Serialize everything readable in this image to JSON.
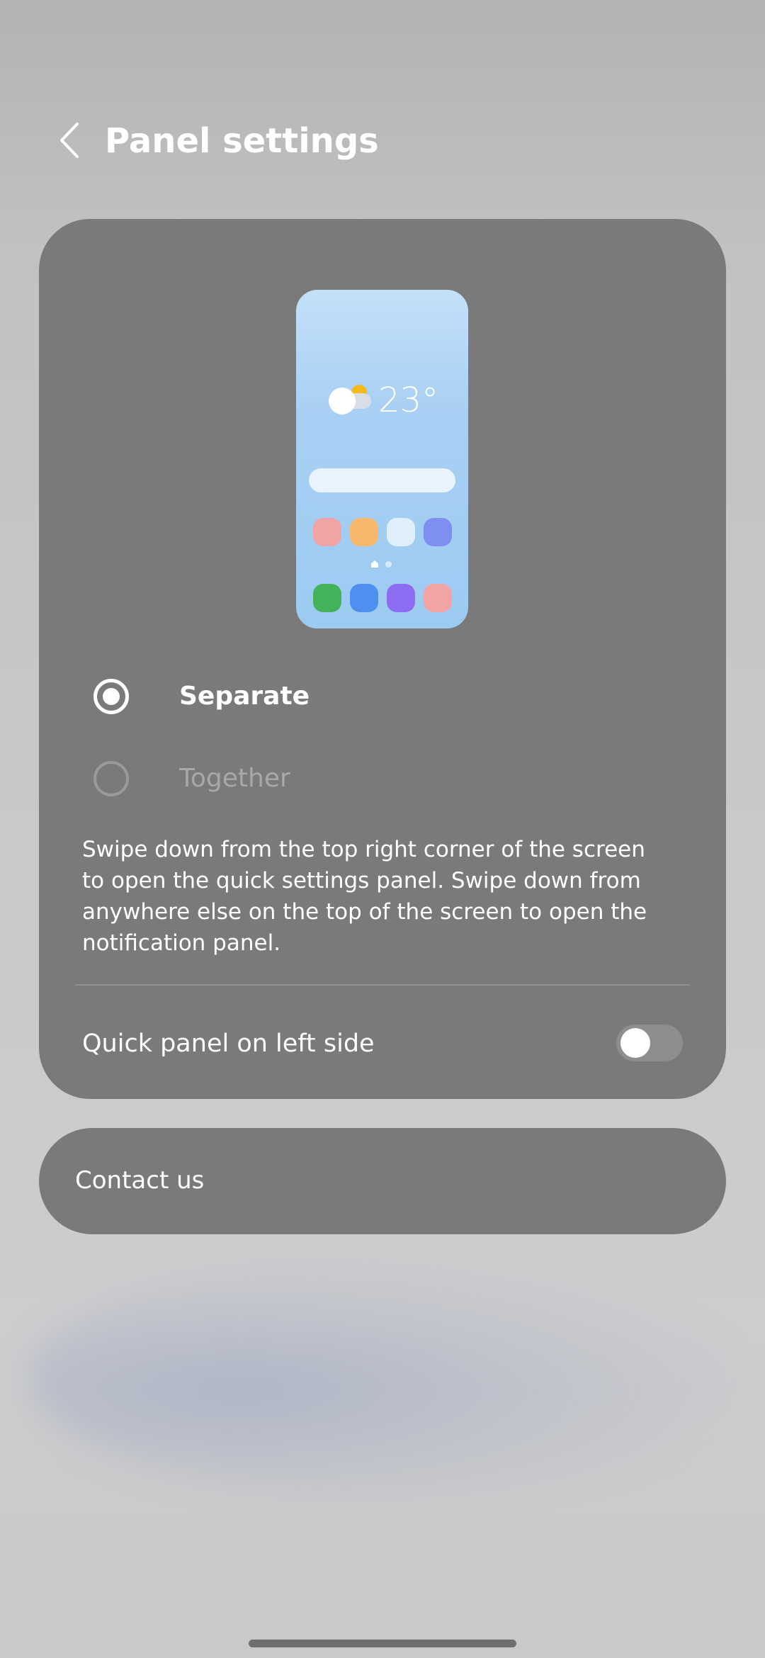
{
  "header": {
    "title": "Panel settings",
    "back_icon": "chevron-left-icon"
  },
  "preview": {
    "temperature": "23°",
    "weather_icon": "partly-cloudy-icon",
    "app_icon_colors_row1": [
      "#f2a3a3",
      "#f8b86c",
      "#dff0fb",
      "#7e8ff0"
    ],
    "app_icon_colors_row2": [
      "#42b35a",
      "#4f8ff0",
      "#8d6cf4",
      "#f2a3a3"
    ]
  },
  "options": {
    "separate_label": "Separate",
    "together_label": "Together",
    "selected": "Separate"
  },
  "description": "Swipe down from the top right corner of the screen to open the quick settings panel. Swipe down from anywhere else on the top of the screen to open the notification panel.",
  "quick_panel": {
    "label": "Quick panel on left side",
    "enabled": false
  },
  "contact": {
    "label": "Contact us"
  },
  "colors": {
    "card": "#7a7a7a",
    "text": "#ffffff",
    "disabled_text": "#a8a8a8"
  }
}
